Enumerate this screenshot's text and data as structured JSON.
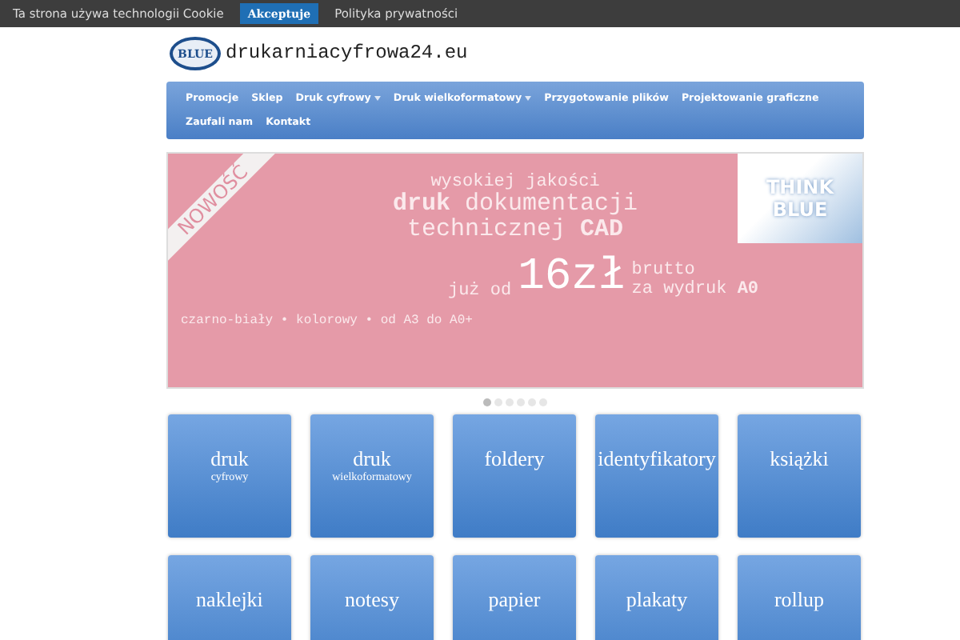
{
  "cookie_bar": {
    "text": "Ta strona używa technologii Cookie",
    "accept_button": "Akceptuje",
    "privacy_link": "Polityka prywatności"
  },
  "logo": {
    "badge": "BLUE",
    "site_name": "drukarniacyfrowa24.eu"
  },
  "nav": {
    "items": [
      {
        "label": "Promocje",
        "dropdown": false
      },
      {
        "label": "Sklep",
        "dropdown": false
      },
      {
        "label": "Druk cyfrowy",
        "dropdown": true
      },
      {
        "label": "Druk wielkoformatowy",
        "dropdown": true
      },
      {
        "label": "Przygotowanie plików",
        "dropdown": false
      },
      {
        "label": "Projektowanie graficzne",
        "dropdown": false
      },
      {
        "label": "Zaufali nam",
        "dropdown": false
      },
      {
        "label": "Kontakt",
        "dropdown": false
      }
    ]
  },
  "banner": {
    "ribbon": "NOWOŚĆ",
    "corner": "THINK BLUE",
    "line_1": "wysokiej jakości",
    "line_2": "**druk** dokumentacji",
    "line_3": "technicznej **CAD**",
    "price_prefix": "już od",
    "price": "16zł",
    "price_suffix_1": "brutto",
    "price_suffix_2": "za wydruk **A0**",
    "footer": "czarno-biały • kolorowy • od A3 do A0+"
  },
  "carousel_dots": [
    {
      "selected": true
    },
    {
      "selected": false
    },
    {
      "selected": false
    },
    {
      "selected": false
    },
    {
      "selected": false
    },
    {
      "selected": false
    }
  ],
  "tiles": [
    {
      "title": "druk",
      "subtitle": "cyfrowy"
    },
    {
      "title": "druk",
      "subtitle": "wielkoformatowy"
    },
    {
      "title": "foldery"
    },
    {
      "title": "identyfikatory"
    },
    {
      "title": "książki"
    },
    {
      "title": "naklejki"
    },
    {
      "title": "notesy"
    },
    {
      "title": "papier"
    },
    {
      "title": "plakaty"
    },
    {
      "title": "rollup"
    }
  ]
}
